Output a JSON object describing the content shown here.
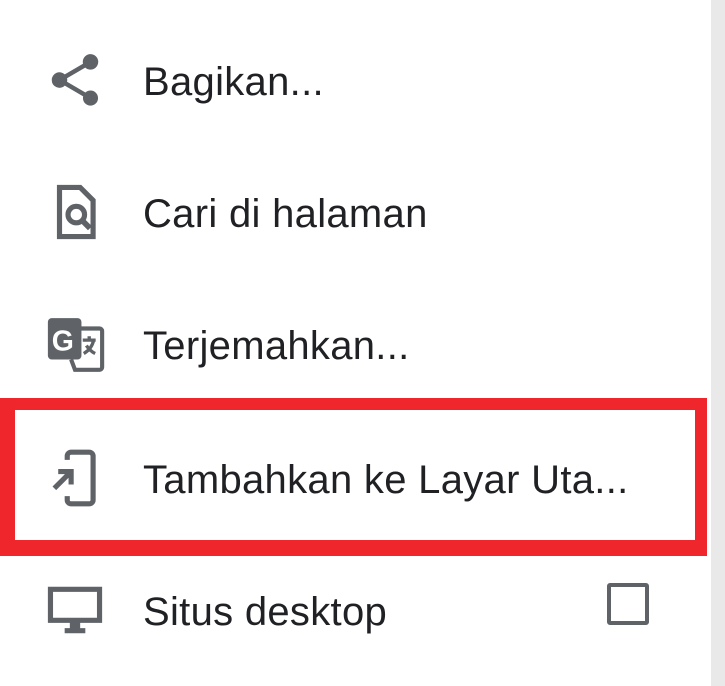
{
  "menu": {
    "items": [
      {
        "label": "Bagikan...",
        "icon": "share-icon"
      },
      {
        "label": "Cari di halaman",
        "icon": "find-in-page-icon"
      },
      {
        "label": "Terjemahkan...",
        "icon": "translate-icon"
      },
      {
        "label": "Tambahkan ke Layar Uta...",
        "icon": "add-to-home-screen-icon"
      },
      {
        "label": "Situs desktop",
        "icon": "desktop-icon",
        "checked": false
      }
    ]
  },
  "colors": {
    "highlight": "#f0262d",
    "icon": "#5f6368",
    "text": "#202124"
  }
}
